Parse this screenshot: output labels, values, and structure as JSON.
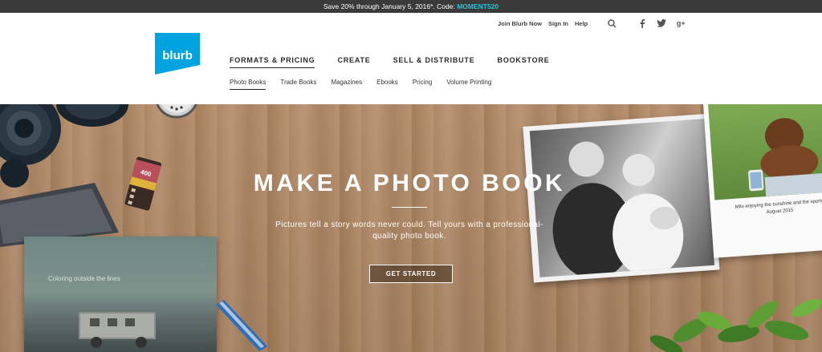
{
  "promo": {
    "text": "Save 20% through January 5, 2016*. Code: ",
    "code": "MOMENT520",
    "code_color": "#28c3d4"
  },
  "utility": {
    "join_label": "Join Blurb Now",
    "signin_label": "Sign In",
    "help_label": "Help",
    "icons": [
      "search-icon",
      "facebook-icon",
      "twitter-icon",
      "google-plus-icon"
    ]
  },
  "logo": {
    "text": "blurb",
    "color": "#00a3e0"
  },
  "nav": {
    "main": [
      "FORMATS & PRICING",
      "CREATE",
      "SELL & DISTRIBUTE",
      "BOOKSTORE"
    ],
    "sub": [
      "Photo Books",
      "Trade Books",
      "Magazines",
      "Ebooks",
      "Pricing",
      "Volume Printing"
    ]
  },
  "hero": {
    "title": "MAKE A PHOTO BOOK",
    "subtitle": "Pictures tell a story words never could. Tell yours with a professional-quality photo book.",
    "cta_label": "GET STARTED",
    "book_caption": "Coloring outside the lines",
    "photo_caption": "Milo enjoying the sunshine and the sports",
    "photo_caption_date": "August 2015",
    "film_label": "400"
  }
}
